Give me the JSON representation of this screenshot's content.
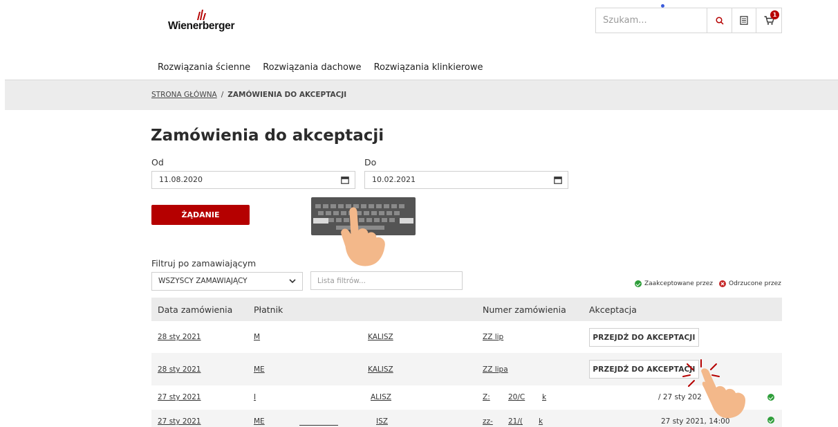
{
  "brand": {
    "name": "Wienerberger",
    "color": "#b50000"
  },
  "header": {
    "search_placeholder": "Szukam...",
    "cart_count": "1"
  },
  "nav": {
    "items": [
      "Rozwiązania ścienne",
      "Rozwiązania dachowe",
      "Rozwiązania klinkierowe"
    ]
  },
  "breadcrumb": {
    "home": "STRONA GŁÓWNA",
    "separator": "/",
    "current": "ZAMÓWIENIA DO AKCEPTACJI"
  },
  "page": {
    "title": "Zamówienia do akceptacji",
    "from_label": "Od",
    "from_value": "11.08.2020",
    "to_label": "Do",
    "to_value": "10.02.2021",
    "submit_label": "ŻĄDANIE"
  },
  "filter": {
    "label": "Filtruj po zamawiającym",
    "selected": "WSZYSCY ZAMAWIAJĄCY",
    "list_placeholder": "Lista filtrów..."
  },
  "legend": {
    "accepted": "Zaakceptowane przez",
    "rejected": "Odrzucone przez",
    "accepted_color": "#2e9e3a",
    "rejected_color": "#c62828"
  },
  "table": {
    "headers": [
      "Data zamówienia",
      "Płatnik",
      "Numer zamówienia",
      "Akceptacja"
    ],
    "rows": [
      {
        "date": "28 sty 2021",
        "payer_start": "M",
        "payer_end": "KALISZ",
        "order": "ZZ lip",
        "action": "PRZEJDŹ DO AKCEPTACJI"
      },
      {
        "date": "28 sty 2021",
        "payer_start": "ME",
        "payer_end": "KALISZ",
        "order": "ZZ lipa",
        "action": "PRZEJDŹ DO AKCEPTACJI"
      },
      {
        "date": "27 sty 2021",
        "payer_start": "I",
        "payer_end": "ALISZ",
        "order_a": "Z:",
        "order_b": "20/C",
        "order_c": "k",
        "acceptance": "/ 27 sty 202",
        "status": "accepted"
      },
      {
        "date": "27 sty 2021",
        "payer_start": "ME",
        "payer_end": "ISZ",
        "order_a": "zz-",
        "order_b": "21/(",
        "order_c": "k",
        "acceptance": "27 sty 2021, 14:00",
        "status": "accepted"
      }
    ]
  }
}
